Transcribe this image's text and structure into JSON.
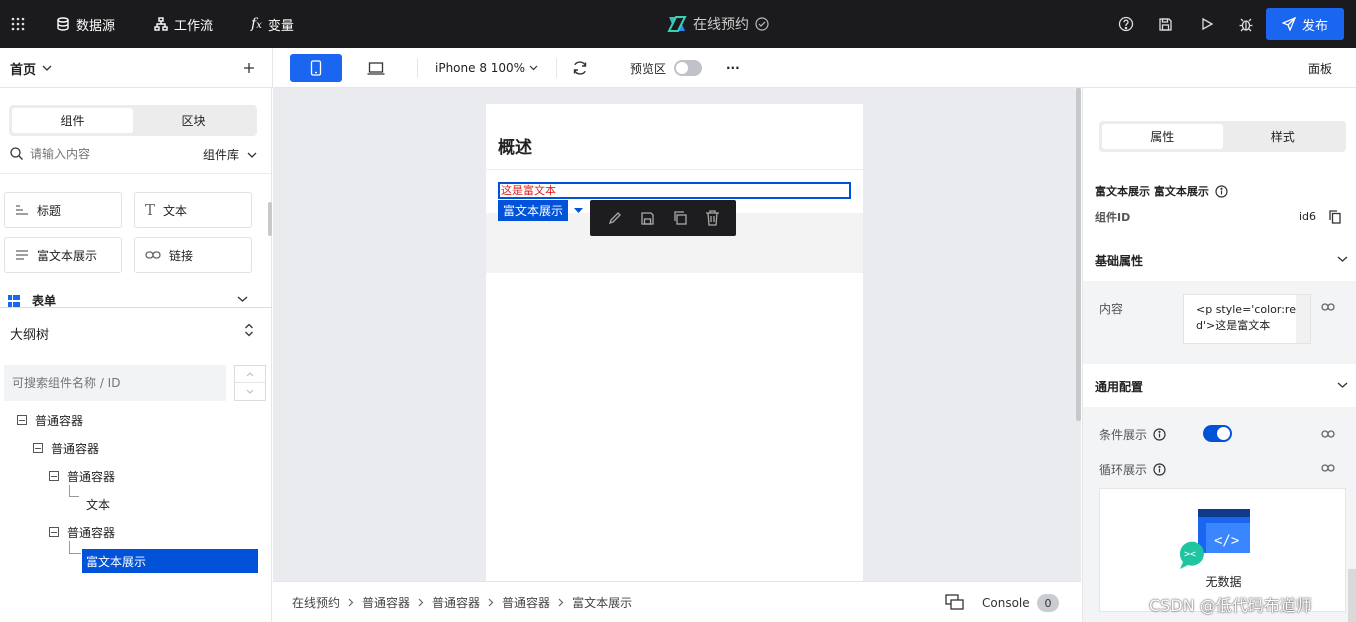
{
  "topbar": {
    "datasource": "数据源",
    "workflow": "工作流",
    "variable": "变量",
    "app_name": "在线预约",
    "publish": "发布"
  },
  "toolbar": {
    "page": "首页",
    "device": "iPhone 8 100%",
    "preview": "预览区",
    "more": "···",
    "panel": "面板"
  },
  "left": {
    "tabs": [
      "组件",
      "区块"
    ],
    "search_placeholder": "请输入内容",
    "library": "组件库",
    "components": [
      "标题",
      "文本",
      "富文本展示",
      "链接"
    ],
    "group_form": "表单",
    "outline_title": "大纲树",
    "outline_search_placeholder": "可搜索组件名称 / ID",
    "tree": [
      {
        "label": "普通容器"
      },
      {
        "label": "普通容器"
      },
      {
        "label": "普通容器"
      },
      {
        "label": "文本"
      },
      {
        "label": "普通容器"
      },
      {
        "label": "富文本展示"
      }
    ]
  },
  "canvas": {
    "heading": "概述",
    "rich_text": "这是富文本",
    "selected_tag": "富文本展示"
  },
  "breadcrumb": [
    "在线预约",
    "普通容器",
    "普通容器",
    "普通容器",
    "富文本展示"
  ],
  "console": {
    "label": "Console",
    "count": "0"
  },
  "right": {
    "tabs": [
      "属性",
      "样式"
    ],
    "component_title": "富文本展示 富文本展示",
    "id_label": "组件ID",
    "id_value": "id6",
    "basic_props": "基础属性",
    "content_label": "内容",
    "content_value": "<p style='color:red'>这是富文本",
    "common_config": "通用配置",
    "cond_show": "条件展示",
    "loop_show": "循环展示",
    "empty": "无数据"
  },
  "watermark": "CSDN @低代码布道师",
  "colors": {
    "accent": "#1a66f0",
    "topbar": "#1b1b1d",
    "selection": "#0052d9",
    "rich_text": "#e02020"
  }
}
